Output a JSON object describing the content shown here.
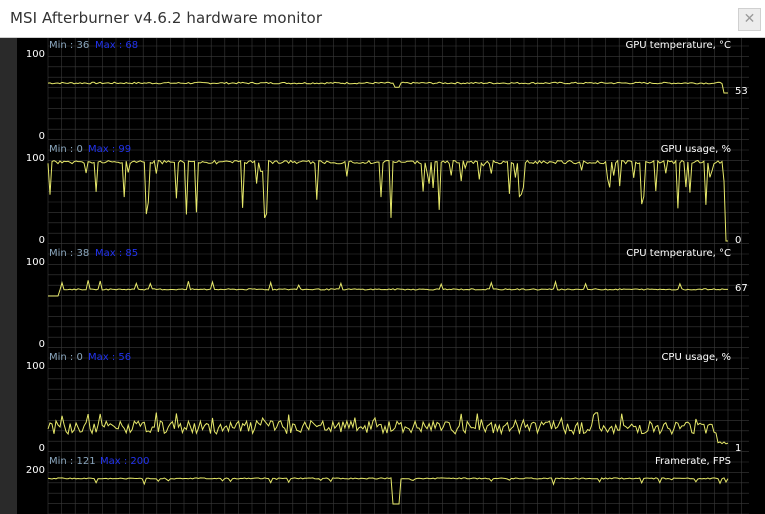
{
  "window": {
    "title": "MSI Afterburner v4.6.2 hardware monitor",
    "close_glyph": "✕"
  },
  "colors": {
    "line": "#e6e86a",
    "grid": "#3a3a3a",
    "background": "#000000",
    "min_label": "#8aa6bd",
    "max_label": "#2233ee"
  },
  "graphs": [
    {
      "name": "GPU temperature, °C",
      "min_label": "Min : 36",
      "max_label": "Max : 68",
      "y_max_label": "100",
      "y_min_label": "0",
      "current": "53",
      "ymax": 100
    },
    {
      "name": "GPU usage, %",
      "min_label": "Min : 0",
      "max_label": "Max : 99",
      "y_max_label": "100",
      "y_min_label": "0",
      "current": "0",
      "ymax": 100
    },
    {
      "name": "CPU temperature, °C",
      "min_label": "Min : 38",
      "max_label": "Max : 85",
      "y_max_label": "100",
      "y_min_label": "0",
      "current": "67",
      "ymax": 100
    },
    {
      "name": "CPU usage, %",
      "min_label": "Min : 0",
      "max_label": "Max : 56",
      "y_max_label": "100",
      "y_min_label": "0",
      "current": "1",
      "ymax": 100
    },
    {
      "name": "Framerate, FPS",
      "min_label": "Min : 121",
      "max_label": "Max : 200",
      "y_max_label": "200",
      "y_min_label": "",
      "current": "",
      "ymax": 200
    }
  ]
}
